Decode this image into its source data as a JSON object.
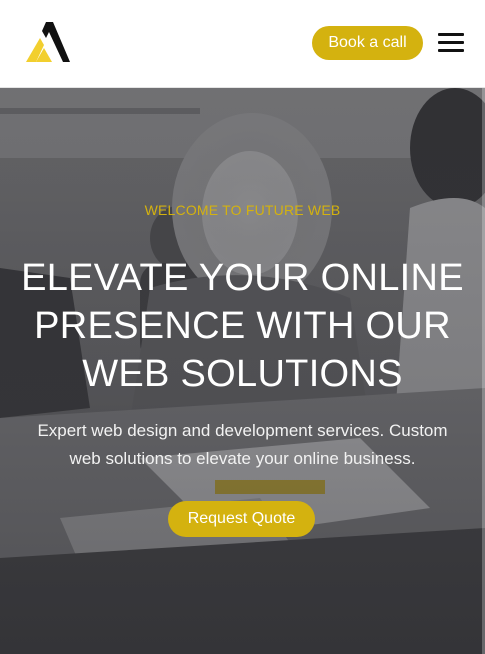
{
  "header": {
    "logo_icon": "triangle-a-logo-icon",
    "book_call_label": "Book a call",
    "menu_icon": "hamburger-menu-icon"
  },
  "hero": {
    "eyebrow": "WELCOME TO FUTURE WEB",
    "headline": "ELEVATE YOUR ONLINE PRESENCE WITH OUR WEB SOLUTIONS",
    "subtext": "Expert web design and development services. Custom web solutions to elevate your online business.",
    "cta_label": "Request Quote",
    "background": "grayscale photo of people working at laptops in an office"
  },
  "colors": {
    "accent": "#d4b20f",
    "logo_yellow": "#f2cf2e",
    "logo_dark": "#111111",
    "header_bg": "#ffffff",
    "headline_text": "#ffffff"
  }
}
